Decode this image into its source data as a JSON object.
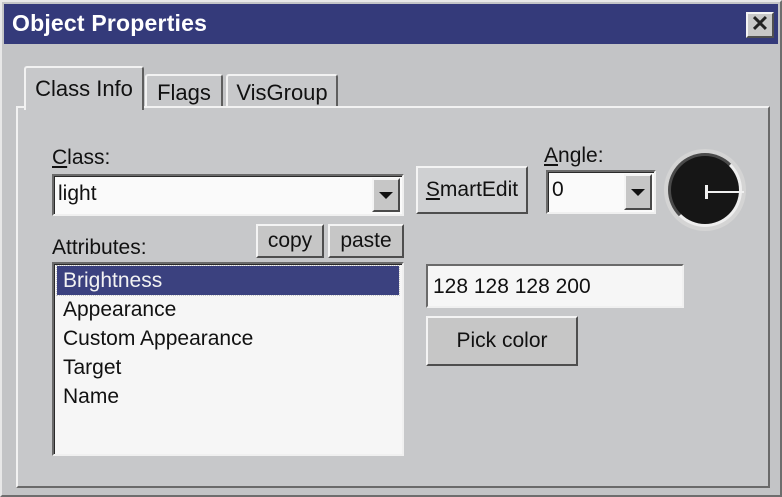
{
  "window": {
    "title": "Object Properties",
    "close_glyph": "✕"
  },
  "tabs": [
    {
      "label": "Class Info",
      "active": true
    },
    {
      "label": "Flags",
      "active": false
    },
    {
      "label": "VisGroup",
      "active": false
    }
  ],
  "class_info": {
    "class_label": "Class:",
    "class_value": "light",
    "smartedit_label": "SmartEdit",
    "angle_label": "Angle:",
    "angle_value": "0",
    "attributes_label": "Attributes:",
    "copy_label": "copy",
    "paste_label": "paste",
    "attributes": [
      {
        "label": "Brightness",
        "selected": true
      },
      {
        "label": "Appearance",
        "selected": false
      },
      {
        "label": "Custom Appearance",
        "selected": false
      },
      {
        "label": "Target",
        "selected": false
      },
      {
        "label": "Name",
        "selected": false
      }
    ],
    "value_text": "128 128 128 200",
    "pick_color_label": "Pick color"
  },
  "icons": {
    "close": "close-icon",
    "dropdown": "chevron-down-icon",
    "dial": "angle-dial-icon"
  },
  "colors": {
    "titlebar": "#343a7a",
    "selection": "#3b417f",
    "face": "#c7c8ca"
  }
}
